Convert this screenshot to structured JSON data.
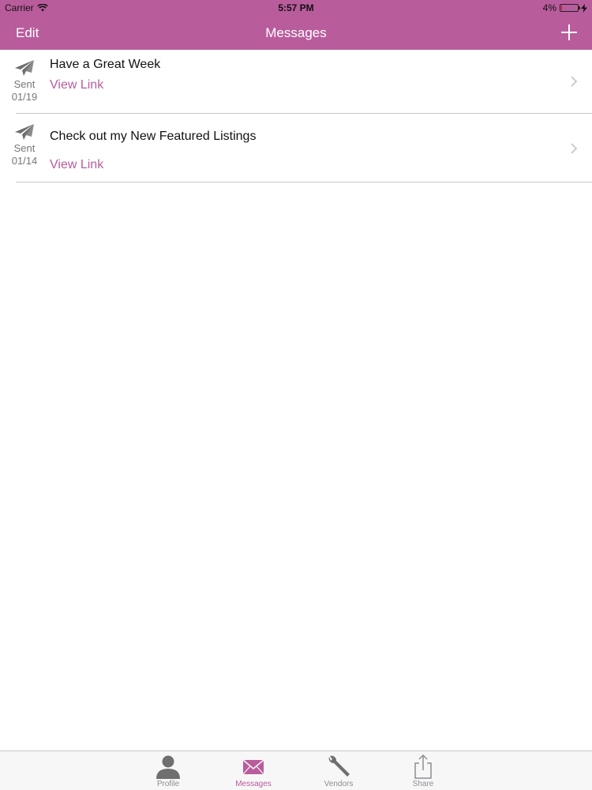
{
  "status_bar": {
    "carrier": "Carrier",
    "time": "5:57 PM",
    "battery_percent": "4%",
    "battery_level": 0.04
  },
  "nav": {
    "edit_label": "Edit",
    "title": "Messages",
    "add_icon": "plus-icon"
  },
  "messages": [
    {
      "title": "Have a Great Week",
      "status": "Sent",
      "date": "01/19",
      "link_label": "View Link",
      "icon": "paper-plane-icon"
    },
    {
      "title": "Check out my New Featured Listings",
      "status": "Sent",
      "date": "01/14",
      "link_label": "View Link",
      "icon": "paper-plane-icon"
    }
  ],
  "tabs": [
    {
      "label": "Profile",
      "icon": "person-icon",
      "active": false
    },
    {
      "label": "Messages",
      "icon": "envelope-icon",
      "active": true
    },
    {
      "label": "Vendors",
      "icon": "wrench-icon",
      "active": false
    },
    {
      "label": "Share",
      "icon": "share-icon",
      "active": false
    }
  ],
  "colors": {
    "accent": "#b95c9c",
    "text": "#111111",
    "secondary_text": "#777777",
    "inactive_tab": "#8e8e93",
    "battery_low": "#d0021b"
  }
}
